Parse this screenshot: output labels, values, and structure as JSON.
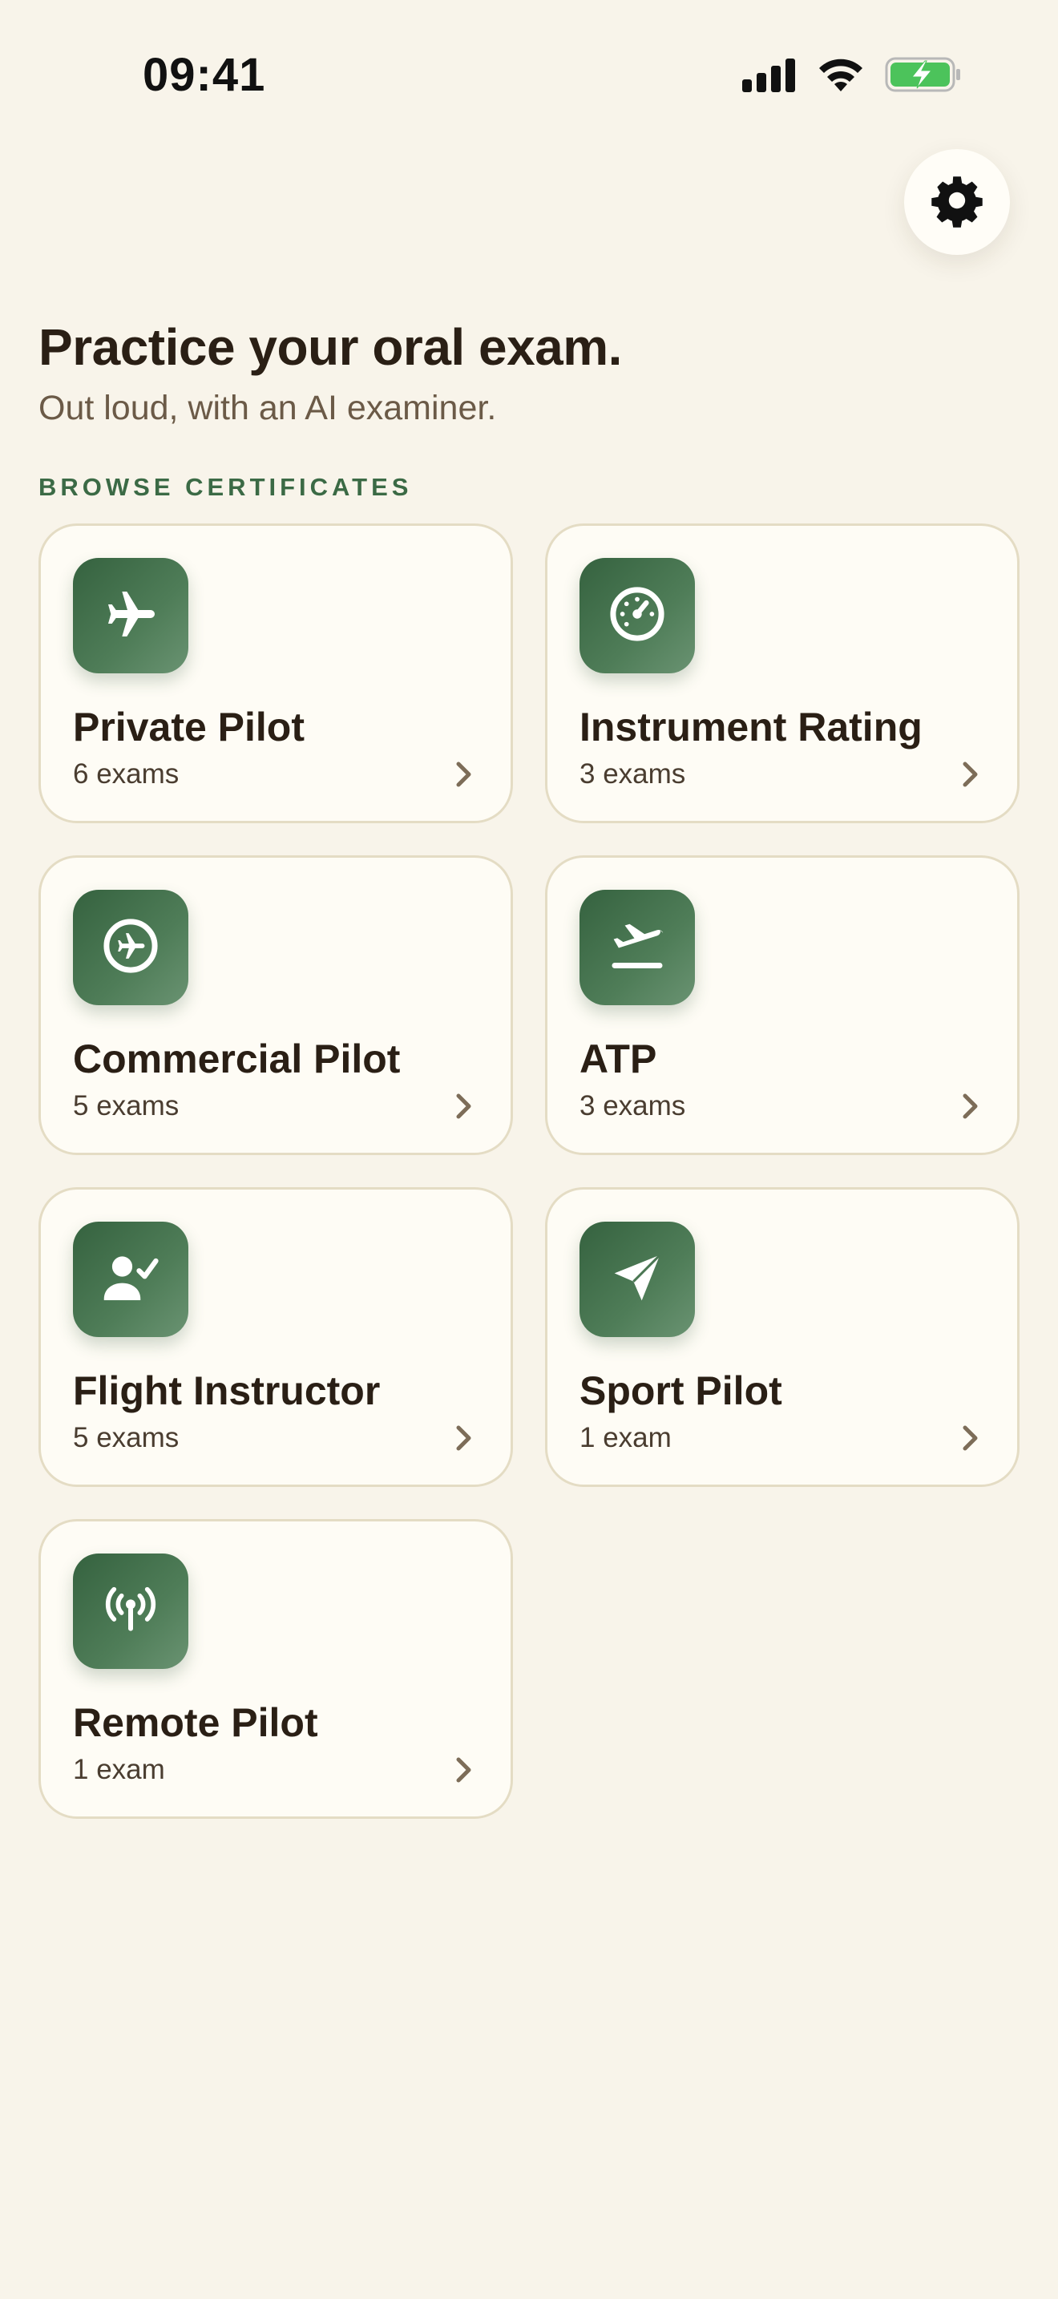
{
  "status_bar": {
    "time": "09:41",
    "icons": [
      "signal-icon",
      "wifi-icon",
      "battery-charging-icon"
    ]
  },
  "header": {
    "settings_icon": "gear-icon",
    "title": "Practice your oral exam.",
    "subtitle": "Out loud, with an AI examiner."
  },
  "section": {
    "label": "BROWSE CERTIFICATES"
  },
  "certificates": [
    {
      "title": "Private Pilot",
      "count": "6 exams",
      "icon": "airplane-icon"
    },
    {
      "title": "Instrument Rating",
      "count": "3 exams",
      "icon": "gauge-icon"
    },
    {
      "title": "Commercial Pilot",
      "count": "5 exams",
      "icon": "airplane-circle-icon"
    },
    {
      "title": "ATP",
      "count": "3 exams",
      "icon": "airplane-departure-icon"
    },
    {
      "title": "Flight Instructor",
      "count": "5 exams",
      "icon": "person-check-icon"
    },
    {
      "title": "Sport Pilot",
      "count": "1 exam",
      "icon": "paper-plane-icon"
    },
    {
      "title": "Remote Pilot",
      "count": "1 exam",
      "icon": "antenna-icon"
    }
  ],
  "colors": {
    "background": "#f8f4ea",
    "card": "#fefcf5",
    "card_border": "#e4dcc4",
    "accent_green": "#3b6a45",
    "battery_green": "#4cc35b"
  }
}
